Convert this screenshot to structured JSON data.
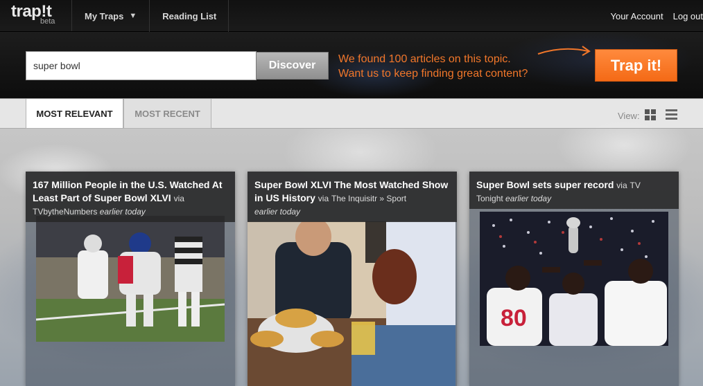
{
  "topnav": {
    "logo_text": "trap!t",
    "logo_sub": "beta",
    "my_traps": "My Traps",
    "reading_list": "Reading List",
    "your_account": "Your Account",
    "log_out": "Log out"
  },
  "search": {
    "value": "super bowl",
    "discover_label": "Discover",
    "found_line1": "We found 100 articles on this topic.",
    "found_line2": "Want us to keep finding great content?",
    "trap_label": "Trap it!"
  },
  "tabs": {
    "most_relevant": "MOST RELEVANT",
    "most_recent": "MOST RECENT",
    "view_label": "View:"
  },
  "cards": [
    {
      "title": "167 Million People in the U.S. Watched At Least Part of Super Bowl XLVI",
      "via": "via",
      "source": "TVbytheNumbers",
      "time": "earlier today"
    },
    {
      "title": "Super Bowl XLVI The Most Watched Show in US History",
      "via": "via",
      "source": "The Inquisitr » Sport",
      "time": "earlier today"
    },
    {
      "title": "Super Bowl sets super record",
      "via": "via",
      "source": "TV",
      "source_line2": "Tonight",
      "time": "earlier today"
    }
  ],
  "colors": {
    "accent_orange": "#f46a16",
    "found_text": "#f2772a"
  },
  "icons": [
    "chevron-down-icon",
    "grid-view-icon",
    "list-view-icon",
    "curved-arrow-icon"
  ]
}
